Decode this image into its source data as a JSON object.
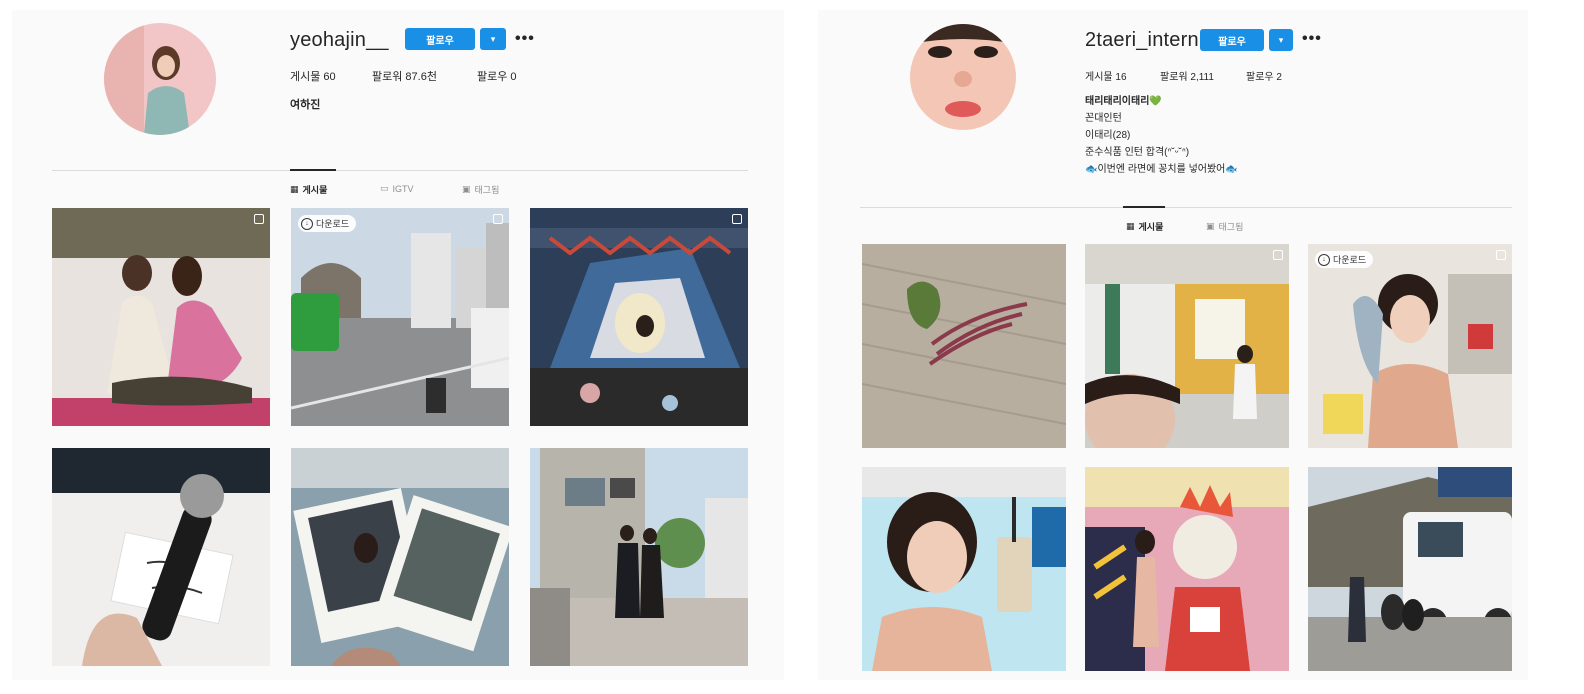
{
  "left_profile": {
    "username": "yeohajin__",
    "follow_label": "팔로우",
    "dropdown_icon": "▾",
    "more_icon": "•••",
    "stats": {
      "posts": "게시물 60",
      "followers": "팔로워 87.6천",
      "following": "팔로우 0"
    },
    "bio_name": "여하진",
    "tabs": {
      "posts": "게시물",
      "igtv": "IGTV",
      "tagged": "태그됨"
    },
    "badge_label": "다운로드",
    "posts": [
      {
        "subject": "two-women-sitting"
      },
      {
        "subject": "city-street-bus"
      },
      {
        "subject": "tent-with-lights"
      },
      {
        "subject": "microphone-note"
      },
      {
        "subject": "polaroid-photos"
      },
      {
        "subject": "couple-in-front-of-house"
      }
    ]
  },
  "right_profile": {
    "username": "2taeri_intern",
    "follow_label": "팔로우",
    "dropdown_icon": "▾",
    "more_icon": "•••",
    "stats": {
      "posts": "게시물 16",
      "followers": "팔로워 2,111",
      "following": "팔로우 2"
    },
    "bio_lines": {
      "name": "태리태리이태리💚",
      "line1": "꼰대인턴",
      "line2": "이태리(28)",
      "line3": "준수식품 인턴 합격(ᐢ˘ᵕ˘ᐢ)",
      "line4": "🐟이번엔 라면에 꽁치를 넣어봤어🐟"
    },
    "tabs": {
      "posts": "게시물",
      "tagged": "태그됨"
    },
    "badge_label": "다운로드",
    "posts": [
      {
        "subject": "lettuce-and-hair-on-floor"
      },
      {
        "subject": "office-selfie"
      },
      {
        "subject": "woman-holding-fish"
      },
      {
        "subject": "bubble-tea-selfie"
      },
      {
        "subject": "mascot-costume"
      },
      {
        "subject": "truck-on-street"
      }
    ]
  }
}
